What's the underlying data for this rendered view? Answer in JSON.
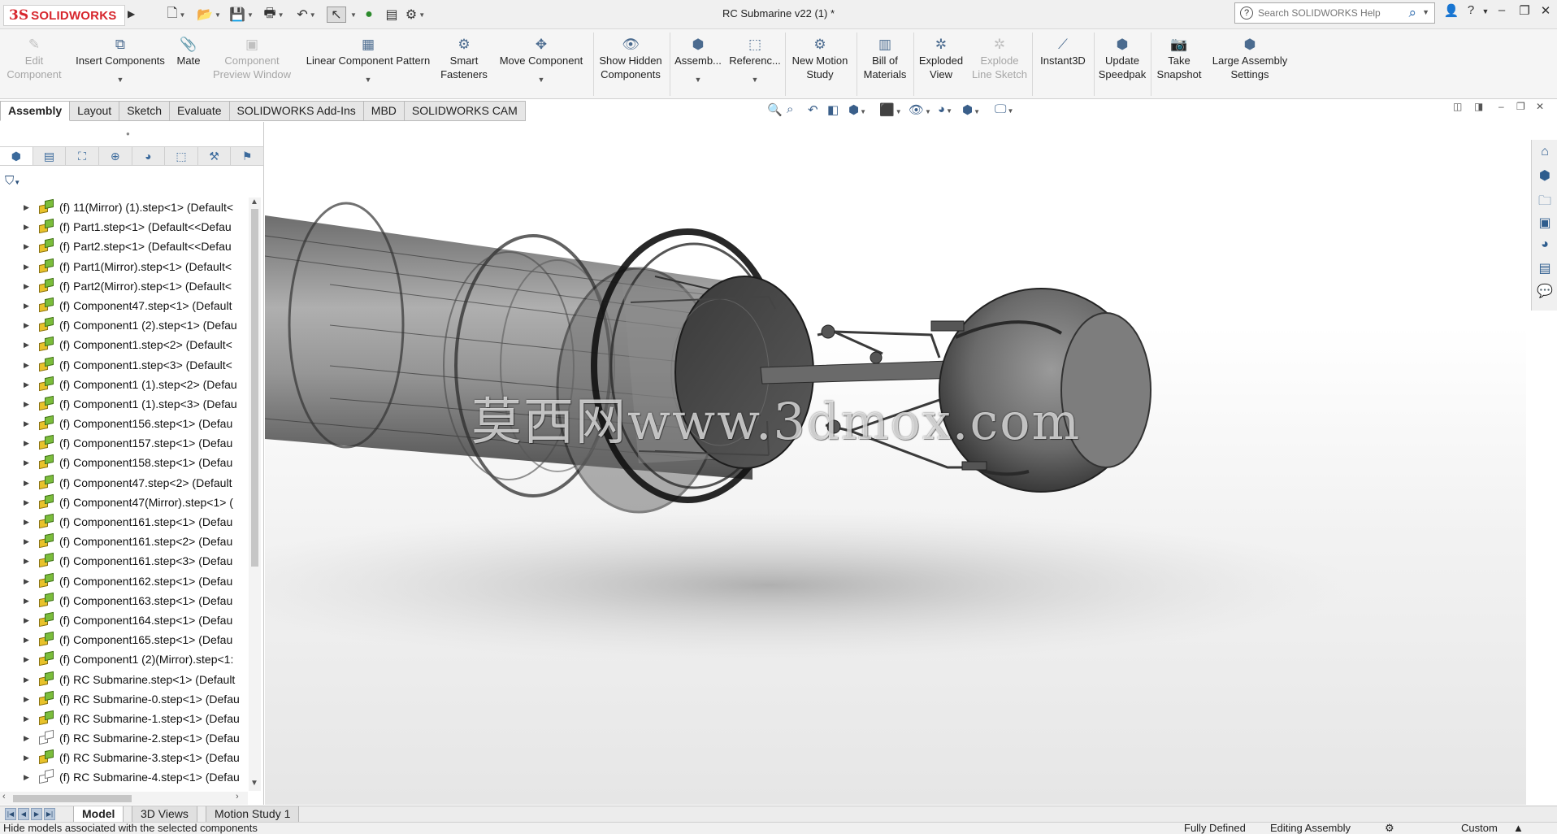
{
  "app": {
    "logo_text": "SOLIDWORKS",
    "document_title": "RC Submarine v22 (1) *",
    "search_placeholder": "Search SOLIDWORKS Help",
    "accent_color": "#d7262d"
  },
  "quick_access": [
    {
      "icon": "new-document-icon",
      "glyph": "🗋"
    },
    {
      "icon": "open-icon",
      "glyph": "📂"
    },
    {
      "icon": "save-icon",
      "glyph": "💾"
    },
    {
      "icon": "print-icon",
      "glyph": "🖶"
    },
    {
      "icon": "undo-icon",
      "glyph": "↶"
    },
    {
      "icon": "select-icon",
      "glyph": "↖"
    },
    {
      "icon": "rebuild-icon",
      "glyph": "🚦"
    },
    {
      "icon": "file-properties-icon",
      "glyph": "▤"
    },
    {
      "icon": "options-icon",
      "glyph": "⚙"
    }
  ],
  "command_manager": {
    "edit_component": "Edit\nComponent",
    "insert_components": "Insert Components",
    "mate": "Mate",
    "component_preview": "Component\nPreview Window",
    "linear_pattern": "Linear Component Pattern",
    "smart_fasteners": "Smart\nFasteners",
    "move_component": "Move Component",
    "show_hidden": "Show Hidden\nComponents",
    "assembly_features": "Assemb...",
    "reference_geometry": "Referenc...",
    "new_motion_study": "New Motion\nStudy",
    "bill_of_materials": "Bill of\nMaterials",
    "exploded_view": "Exploded\nView",
    "explode_line_sketch": "Explode\nLine Sketch",
    "instant3d": "Instant3D",
    "update_speedpak": "Update\nSpeedpak",
    "take_snapshot": "Take\nSnapshot",
    "large_assembly_settings": "Large Assembly\nSettings"
  },
  "tabs": [
    "Assembly",
    "Layout",
    "Sketch",
    "Evaluate",
    "SOLIDWORKS Add-Ins",
    "MBD",
    "SOLIDWORKS CAM"
  ],
  "active_tab": "Assembly",
  "feature_tree": [
    {
      "label": "(f) 11(Mirror) (1).step<1> (Default<",
      "suppressed": false
    },
    {
      "label": "(f) Part1.step<1> (Default<<Defau",
      "suppressed": false
    },
    {
      "label": "(f) Part2.step<1> (Default<<Defau",
      "suppressed": false
    },
    {
      "label": "(f) Part1(Mirror).step<1> (Default<",
      "suppressed": false
    },
    {
      "label": "(f) Part2(Mirror).step<1> (Default<",
      "suppressed": false
    },
    {
      "label": "(f) Component47.step<1> (Default",
      "suppressed": false
    },
    {
      "label": "(f) Component1 (2).step<1> (Defau",
      "suppressed": false
    },
    {
      "label": "(f) Component1.step<2> (Default<",
      "suppressed": false
    },
    {
      "label": "(f) Component1.step<3> (Default<",
      "suppressed": false
    },
    {
      "label": "(f) Component1 (1).step<2> (Defau",
      "suppressed": false
    },
    {
      "label": "(f) Component1 (1).step<3> (Defau",
      "suppressed": false
    },
    {
      "label": "(f) Component156.step<1> (Defau",
      "suppressed": false
    },
    {
      "label": "(f) Component157.step<1> (Defau",
      "suppressed": false
    },
    {
      "label": "(f) Component158.step<1> (Defau",
      "suppressed": false
    },
    {
      "label": "(f) Component47.step<2> (Default",
      "suppressed": false
    },
    {
      "label": "(f) Component47(Mirror).step<1> (",
      "suppressed": false
    },
    {
      "label": "(f) Component161.step<1> (Defau",
      "suppressed": false
    },
    {
      "label": "(f) Component161.step<2> (Defau",
      "suppressed": false
    },
    {
      "label": "(f) Component161.step<3> (Defau",
      "suppressed": false
    },
    {
      "label": "(f) Component162.step<1> (Defau",
      "suppressed": false
    },
    {
      "label": "(f) Component163.step<1> (Defau",
      "suppressed": false
    },
    {
      "label": "(f) Component164.step<1> (Defau",
      "suppressed": false
    },
    {
      "label": "(f) Component165.step<1> (Defau",
      "suppressed": false
    },
    {
      "label": "(f) Component1 (2)(Mirror).step<1:",
      "suppressed": false
    },
    {
      "label": "(f) RC Submarine.step<1> (Default",
      "suppressed": false
    },
    {
      "label": "(f) RC Submarine-0.step<1> (Defau",
      "suppressed": false
    },
    {
      "label": "(f) RC Submarine-1.step<1> (Defau",
      "suppressed": false
    },
    {
      "label": "(f) RC Submarine-2.step<1> (Defau",
      "suppressed": true
    },
    {
      "label": "(f) RC Submarine-3.step<1> (Defau",
      "suppressed": false
    },
    {
      "label": "(f) RC Submarine-4.step<1> (Defau",
      "suppressed": true
    }
  ],
  "viewport": {
    "watermark": "莫西网www.3dmox.com"
  },
  "bottom_tabs": [
    "Model",
    "3D Views",
    "Motion Study 1"
  ],
  "active_bottom_tab": "Model",
  "status": {
    "message": "Hide models associated with the selected components",
    "definition": "Fully Defined",
    "mode": "Editing Assembly",
    "units": "Custom"
  }
}
